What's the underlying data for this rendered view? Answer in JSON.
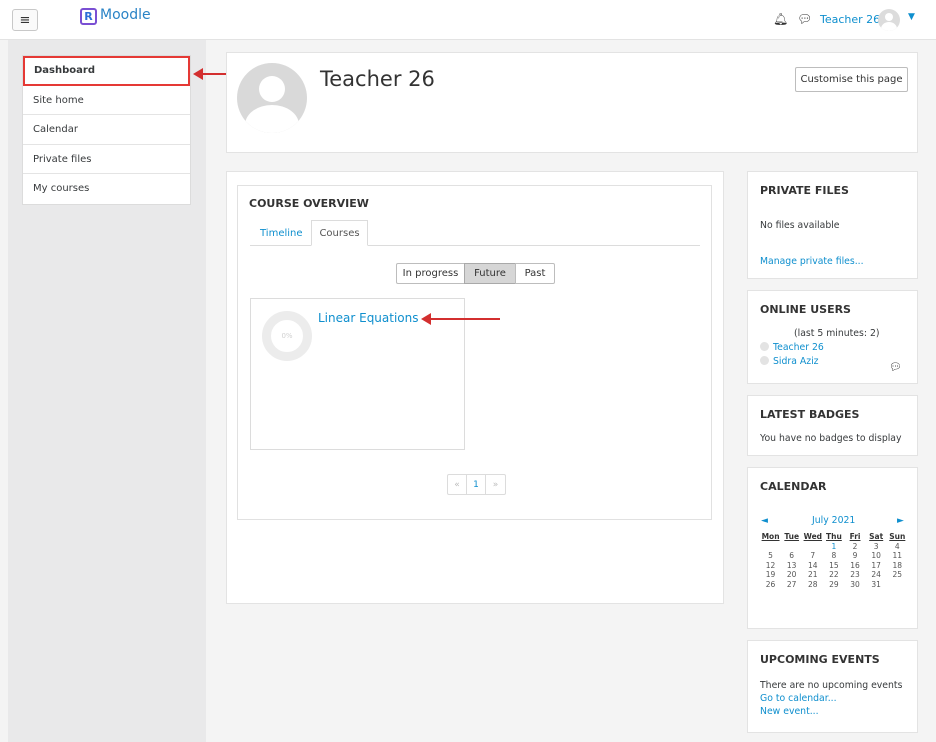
{
  "app": {
    "name": "Moodle",
    "logo_letter": "R"
  },
  "navbar": {
    "user_name": "Teacher 26",
    "bell_icon": "bell-icon",
    "chat_icon": "chat-icon",
    "menu_icon": "hamburger-icon"
  },
  "sidebar": {
    "items": [
      {
        "label": "Dashboard"
      },
      {
        "label": "Site home"
      },
      {
        "label": "Calendar"
      },
      {
        "label": "Private files"
      },
      {
        "label": "My courses"
      }
    ]
  },
  "header": {
    "title": "Teacher 26",
    "customise_label": "Customise this page"
  },
  "overview": {
    "title": "COURSE OVERVIEW",
    "tabs": [
      {
        "label": "Timeline"
      },
      {
        "label": "Courses"
      }
    ],
    "filters": [
      {
        "label": "In progress"
      },
      {
        "label": "Future"
      },
      {
        "label": "Past"
      }
    ],
    "course": {
      "name": "Linear Equations",
      "progress_text": "0%"
    },
    "pager": {
      "prev": "«",
      "page": "1",
      "next": "»"
    }
  },
  "blocks": {
    "private_files": {
      "title": "PRIVATE FILES",
      "empty": "No files available",
      "manage": "Manage private files..."
    },
    "online_users": {
      "title": "ONLINE USERS",
      "subtitle": "(last 5 minutes: 2)",
      "users": [
        "Teacher 26",
        "Sidra Aziz"
      ]
    },
    "latest_badges": {
      "title": "LATEST BADGES",
      "empty": "You have no badges to display"
    },
    "calendar": {
      "title": "CALENDAR",
      "month": "July 2021",
      "prev": "◄",
      "next": "►",
      "days": [
        "Mon",
        "Tue",
        "Wed",
        "Thu",
        "Fri",
        "Sat",
        "Sun"
      ],
      "weeks": [
        [
          "",
          "",
          "",
          "1",
          "2",
          "3",
          "4"
        ],
        [
          "5",
          "6",
          "7",
          "8",
          "9",
          "10",
          "11"
        ],
        [
          "12",
          "13",
          "14",
          "15",
          "16",
          "17",
          "18"
        ],
        [
          "19",
          "20",
          "21",
          "22",
          "23",
          "24",
          "25"
        ],
        [
          "26",
          "27",
          "28",
          "29",
          "30",
          "31",
          ""
        ]
      ],
      "highlight": "1"
    },
    "upcoming_events": {
      "title": "UPCOMING EVENTS",
      "empty": "There are no upcoming events",
      "go_calendar": "Go to calendar...",
      "new_event": "New event..."
    }
  },
  "colors": {
    "link": "#0f8fce",
    "annotation_arrow": "#d32f2f",
    "active_border": "#e53935"
  }
}
